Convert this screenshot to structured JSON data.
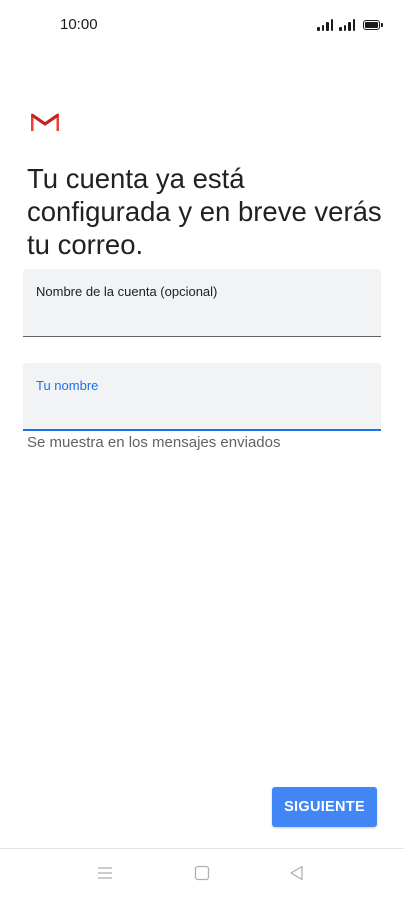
{
  "status_bar": {
    "time": "10:00",
    "icons": [
      "signal-icon",
      "signal-icon",
      "battery-icon"
    ]
  },
  "logo": {
    "name": "gmail-logo",
    "colors": {
      "red": "#ea4335",
      "dark_red": "#c5221f",
      "gray": "#d8d8d8"
    }
  },
  "heading": "Tu cuenta ya está\nconfigurada y en breve verás\ntu correo.",
  "fields": {
    "account_name": {
      "label": "Nombre de la cuenta (opcional)",
      "value": ""
    },
    "your_name": {
      "label": "Tu nombre",
      "value": "",
      "focused": true
    }
  },
  "helper_text": "Se muestra en los mensajes enviados",
  "next_button": {
    "label": "SIGUIENTE",
    "color": "#4285f4"
  },
  "nav_bar": {
    "icons": [
      "menu-icon",
      "home-icon",
      "back-icon"
    ]
  }
}
